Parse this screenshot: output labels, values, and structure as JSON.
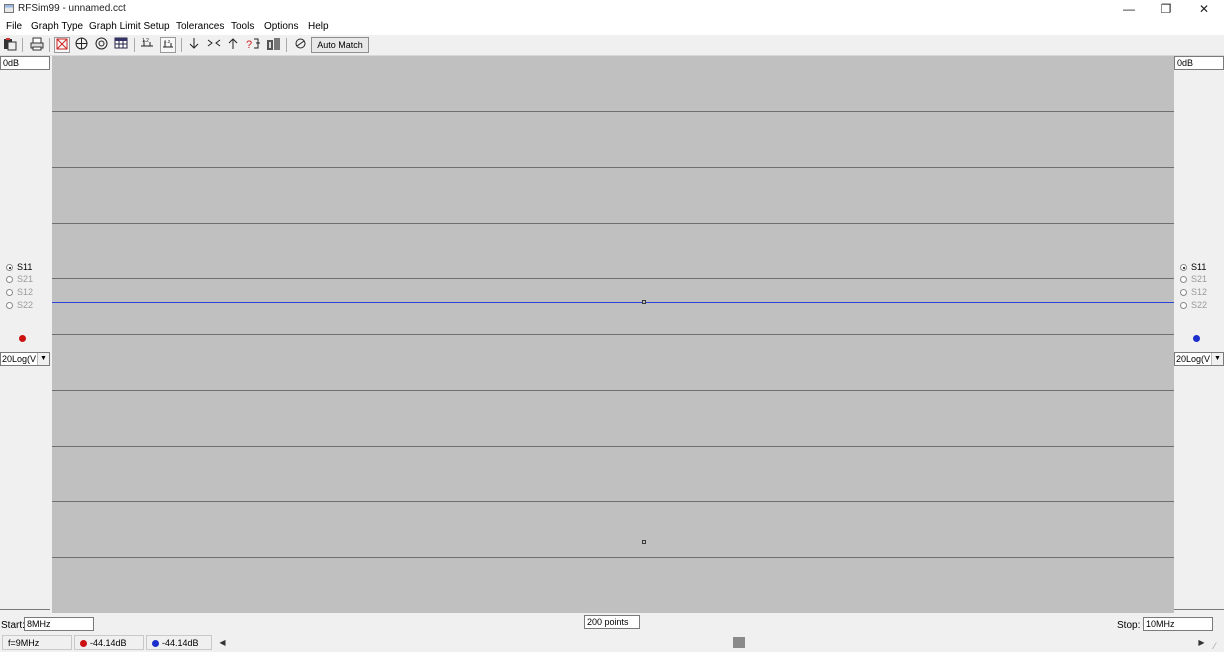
{
  "window": {
    "title": "RFSim99 - unnamed.cct",
    "minimize_glyph": "—",
    "restore_glyph": "❐",
    "close_glyph": "✕"
  },
  "menu": [
    "File",
    "Graph Type",
    "Graph Limit Setup",
    "Tolerances",
    "Tools",
    "Options",
    "Help"
  ],
  "toolbar": {
    "icons": [
      "clipboard-icon",
      "print-icon",
      "smith-chart-icon",
      "polar-chart-icon",
      "rect-chart-icon",
      "table-icon",
      "limit-icon",
      "limit-expand-icon",
      "arrow-down-icon",
      "arrow-in-icon",
      "arrow-up-icon",
      "help-icon",
      "components-icon",
      "match-icon"
    ],
    "auto_match_label": "Auto Match"
  },
  "left_panel": {
    "top_limit": "0dB",
    "params": [
      {
        "label": "S11",
        "checked": true,
        "enabled": true
      },
      {
        "label": "S21",
        "checked": false,
        "enabled": false
      },
      {
        "label": "S12",
        "checked": false,
        "enabled": false
      },
      {
        "label": "S22",
        "checked": false,
        "enabled": false
      }
    ],
    "trace_color": "#cc1111",
    "format": "20Log(V"
  },
  "right_panel": {
    "top_limit": "0dB",
    "params": [
      {
        "label": "S11",
        "checked": true,
        "enabled": true
      },
      {
        "label": "S21",
        "checked": false,
        "enabled": false
      },
      {
        "label": "S12",
        "checked": false,
        "enabled": false
      },
      {
        "label": "S22",
        "checked": false,
        "enabled": false
      }
    ],
    "trace_color": "#1a2fcc",
    "format": "20Log(V"
  },
  "plot": {
    "background": "#c0c0c0",
    "trace_color": "#2d44d8"
  },
  "sweep": {
    "start_label": "Start:",
    "start_value": "8MHz",
    "points": "200 points",
    "stop_label": "Stop:",
    "stop_value": "10MHz"
  },
  "status": {
    "freq": "f=9MHz",
    "left_reading": "-44.14dB",
    "right_reading": "-44.14dB"
  }
}
